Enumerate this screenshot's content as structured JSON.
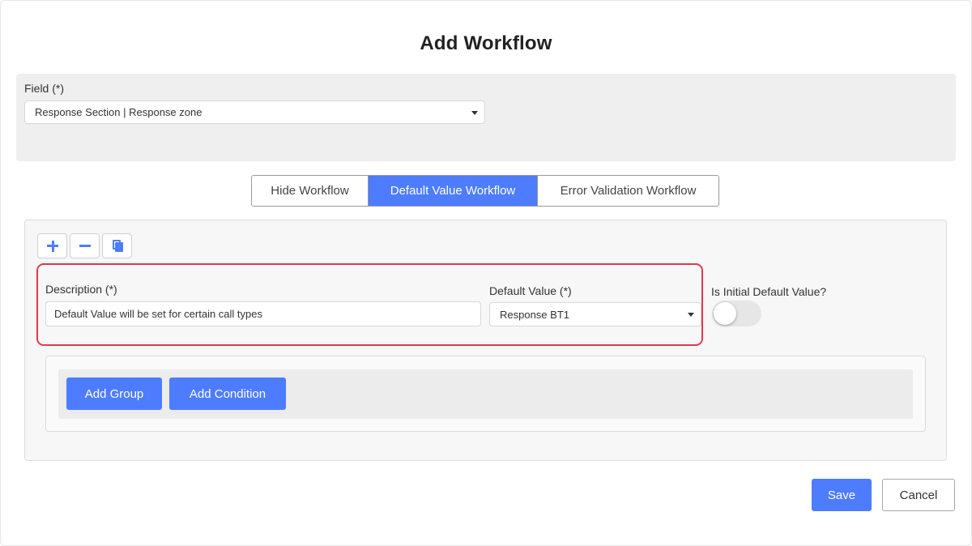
{
  "dialog": {
    "title": "Add Workflow"
  },
  "field": {
    "label": "Field (*)",
    "value": "Response Section | Response zone"
  },
  "tabs": [
    {
      "label": "Hide Workflow",
      "active": false
    },
    {
      "label": "Default Value Workflow",
      "active": true
    },
    {
      "label": "Error Validation Workflow",
      "active": false
    }
  ],
  "toolbar": {
    "add_icon": "plus-icon",
    "remove_icon": "minus-icon",
    "copy_icon": "copy-icon"
  },
  "form": {
    "description_label": "Description (*)",
    "description_value": "Default Value will be set for certain call types",
    "default_value_label": "Default Value (*)",
    "default_value_selected": "Response BT1",
    "initial_default_label": "Is Initial Default Value?",
    "initial_default_on": false
  },
  "conditions": {
    "add_group_label": "Add Group",
    "add_condition_label": "Add Condition"
  },
  "footer": {
    "save_label": "Save",
    "cancel_label": "Cancel"
  },
  "colors": {
    "accent": "#4d7cfe",
    "highlight": "#e0394f"
  }
}
